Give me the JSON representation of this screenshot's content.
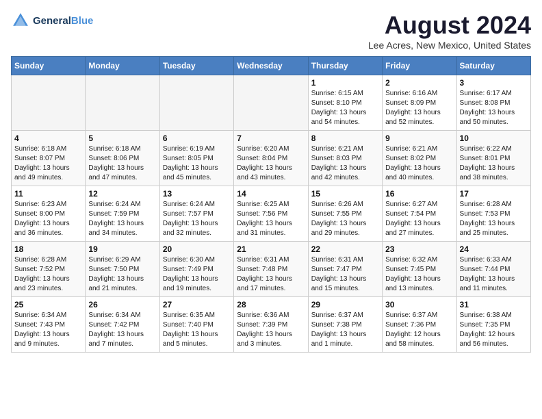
{
  "header": {
    "logo_line1": "General",
    "logo_line2": "Blue",
    "main_title": "August 2024",
    "subtitle": "Lee Acres, New Mexico, United States"
  },
  "calendar": {
    "days_of_week": [
      "Sunday",
      "Monday",
      "Tuesday",
      "Wednesday",
      "Thursday",
      "Friday",
      "Saturday"
    ],
    "weeks": [
      [
        {
          "day": "",
          "info": ""
        },
        {
          "day": "",
          "info": ""
        },
        {
          "day": "",
          "info": ""
        },
        {
          "day": "",
          "info": ""
        },
        {
          "day": "1",
          "info": "Sunrise: 6:15 AM\nSunset: 8:10 PM\nDaylight: 13 hours\nand 54 minutes."
        },
        {
          "day": "2",
          "info": "Sunrise: 6:16 AM\nSunset: 8:09 PM\nDaylight: 13 hours\nand 52 minutes."
        },
        {
          "day": "3",
          "info": "Sunrise: 6:17 AM\nSunset: 8:08 PM\nDaylight: 13 hours\nand 50 minutes."
        }
      ],
      [
        {
          "day": "4",
          "info": "Sunrise: 6:18 AM\nSunset: 8:07 PM\nDaylight: 13 hours\nand 49 minutes."
        },
        {
          "day": "5",
          "info": "Sunrise: 6:18 AM\nSunset: 8:06 PM\nDaylight: 13 hours\nand 47 minutes."
        },
        {
          "day": "6",
          "info": "Sunrise: 6:19 AM\nSunset: 8:05 PM\nDaylight: 13 hours\nand 45 minutes."
        },
        {
          "day": "7",
          "info": "Sunrise: 6:20 AM\nSunset: 8:04 PM\nDaylight: 13 hours\nand 43 minutes."
        },
        {
          "day": "8",
          "info": "Sunrise: 6:21 AM\nSunset: 8:03 PM\nDaylight: 13 hours\nand 42 minutes."
        },
        {
          "day": "9",
          "info": "Sunrise: 6:21 AM\nSunset: 8:02 PM\nDaylight: 13 hours\nand 40 minutes."
        },
        {
          "day": "10",
          "info": "Sunrise: 6:22 AM\nSunset: 8:01 PM\nDaylight: 13 hours\nand 38 minutes."
        }
      ],
      [
        {
          "day": "11",
          "info": "Sunrise: 6:23 AM\nSunset: 8:00 PM\nDaylight: 13 hours\nand 36 minutes."
        },
        {
          "day": "12",
          "info": "Sunrise: 6:24 AM\nSunset: 7:59 PM\nDaylight: 13 hours\nand 34 minutes."
        },
        {
          "day": "13",
          "info": "Sunrise: 6:24 AM\nSunset: 7:57 PM\nDaylight: 13 hours\nand 32 minutes."
        },
        {
          "day": "14",
          "info": "Sunrise: 6:25 AM\nSunset: 7:56 PM\nDaylight: 13 hours\nand 31 minutes."
        },
        {
          "day": "15",
          "info": "Sunrise: 6:26 AM\nSunset: 7:55 PM\nDaylight: 13 hours\nand 29 minutes."
        },
        {
          "day": "16",
          "info": "Sunrise: 6:27 AM\nSunset: 7:54 PM\nDaylight: 13 hours\nand 27 minutes."
        },
        {
          "day": "17",
          "info": "Sunrise: 6:28 AM\nSunset: 7:53 PM\nDaylight: 13 hours\nand 25 minutes."
        }
      ],
      [
        {
          "day": "18",
          "info": "Sunrise: 6:28 AM\nSunset: 7:52 PM\nDaylight: 13 hours\nand 23 minutes."
        },
        {
          "day": "19",
          "info": "Sunrise: 6:29 AM\nSunset: 7:50 PM\nDaylight: 13 hours\nand 21 minutes."
        },
        {
          "day": "20",
          "info": "Sunrise: 6:30 AM\nSunset: 7:49 PM\nDaylight: 13 hours\nand 19 minutes."
        },
        {
          "day": "21",
          "info": "Sunrise: 6:31 AM\nSunset: 7:48 PM\nDaylight: 13 hours\nand 17 minutes."
        },
        {
          "day": "22",
          "info": "Sunrise: 6:31 AM\nSunset: 7:47 PM\nDaylight: 13 hours\nand 15 minutes."
        },
        {
          "day": "23",
          "info": "Sunrise: 6:32 AM\nSunset: 7:45 PM\nDaylight: 13 hours\nand 13 minutes."
        },
        {
          "day": "24",
          "info": "Sunrise: 6:33 AM\nSunset: 7:44 PM\nDaylight: 13 hours\nand 11 minutes."
        }
      ],
      [
        {
          "day": "25",
          "info": "Sunrise: 6:34 AM\nSunset: 7:43 PM\nDaylight: 13 hours\nand 9 minutes."
        },
        {
          "day": "26",
          "info": "Sunrise: 6:34 AM\nSunset: 7:42 PM\nDaylight: 13 hours\nand 7 minutes."
        },
        {
          "day": "27",
          "info": "Sunrise: 6:35 AM\nSunset: 7:40 PM\nDaylight: 13 hours\nand 5 minutes."
        },
        {
          "day": "28",
          "info": "Sunrise: 6:36 AM\nSunset: 7:39 PM\nDaylight: 13 hours\nand 3 minutes."
        },
        {
          "day": "29",
          "info": "Sunrise: 6:37 AM\nSunset: 7:38 PM\nDaylight: 13 hours\nand 1 minute."
        },
        {
          "day": "30",
          "info": "Sunrise: 6:37 AM\nSunset: 7:36 PM\nDaylight: 12 hours\nand 58 minutes."
        },
        {
          "day": "31",
          "info": "Sunrise: 6:38 AM\nSunset: 7:35 PM\nDaylight: 12 hours\nand 56 minutes."
        }
      ]
    ]
  }
}
